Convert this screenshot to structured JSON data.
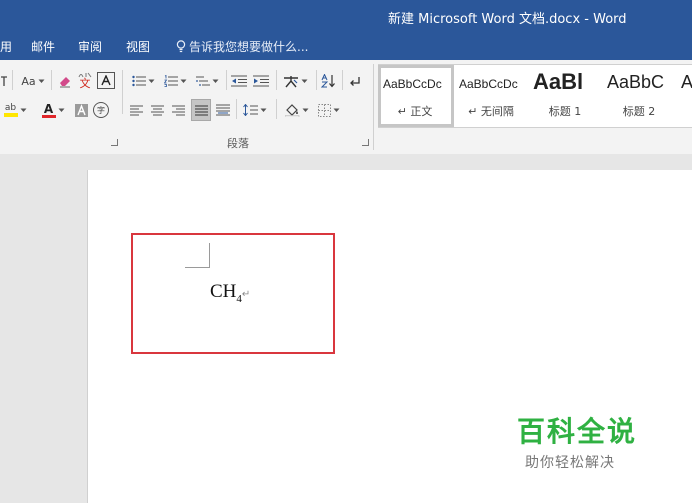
{
  "window": {
    "title": "新建 Microsoft Word 文档.docx - Word"
  },
  "tabs": [
    "用",
    "邮件",
    "审阅",
    "视图"
  ],
  "tell_me": "告诉我您想要做什么...",
  "ribbon": {
    "font": {
      "case_label": "Aa",
      "phonetic_glyph": "文",
      "highlight_label": "ab",
      "font_color_label": "A",
      "enclose_glyph": "字"
    },
    "paragraph": {
      "label": "段落"
    }
  },
  "styles": [
    {
      "preview": "AaBbCcDc",
      "name": "↵ 正文",
      "selected": true
    },
    {
      "preview": "AaBbCcDc",
      "name": "↵ 无间隔",
      "selected": false
    },
    {
      "preview": "AaBl",
      "name": "标题 1",
      "selected": false
    },
    {
      "preview": "AaBbC",
      "name": "标题 2",
      "selected": false
    },
    {
      "preview": "A",
      "name": "",
      "selected": false
    }
  ],
  "document": {
    "formula_main": "CH",
    "formula_sub": "4",
    "paragraph_mark": "↵"
  },
  "colors": {
    "title_bar": "#2b579a",
    "highlight_box": "#d9363e",
    "watermark": "#2fb142",
    "font_color": "#e0262a",
    "highlight_color": "#ffe600"
  },
  "watermark": {
    "title": "百科全说",
    "subtitle": "助你轻松解决"
  }
}
